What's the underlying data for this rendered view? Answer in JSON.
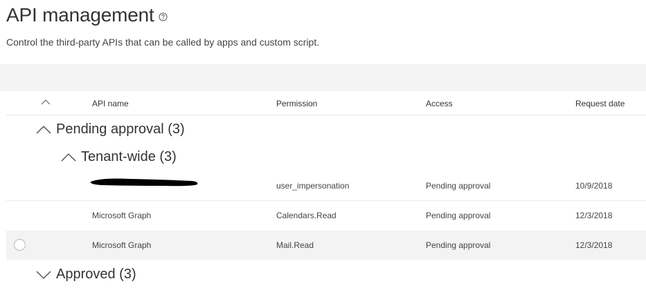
{
  "page": {
    "title": "API management",
    "subtitle": "Control the third-party APIs that can be called by apps and custom script."
  },
  "table": {
    "columns": [
      "API name",
      "Permission",
      "Access",
      "Request date"
    ],
    "groups": {
      "pending": "Pending approval (3)",
      "tenant_wide": "Tenant-wide (3)",
      "approved": "Approved (3)"
    },
    "rows": [
      {
        "api_name": "",
        "permission": "user_impersonation",
        "access": "Pending approval",
        "request_date": "10/9/2018"
      },
      {
        "api_name": "Microsoft Graph",
        "permission": "Calendars.Read",
        "access": "Pending approval",
        "request_date": "12/3/2018"
      },
      {
        "api_name": "Microsoft Graph",
        "permission": "Mail.Read",
        "access": "Pending approval",
        "request_date": "12/3/2018"
      }
    ]
  },
  "icons": {
    "help": "help-circle-icon",
    "collapse_all": "chevron-up-icon",
    "expanded": "chevron-up-icon",
    "collapsed": "chevron-down-icon"
  },
  "colors": {
    "command_bar": "#f4f4f4",
    "hover_row": "#f3f3f3",
    "text": "#323130"
  }
}
